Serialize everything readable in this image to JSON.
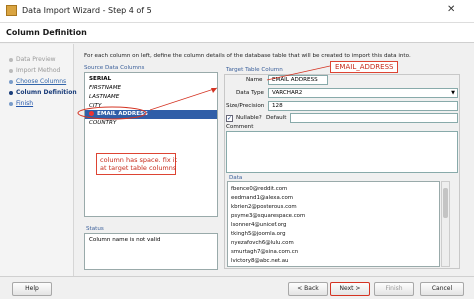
{
  "window": {
    "title": "Data Import Wizard - Step 4 of 5",
    "close_glyph": "✕"
  },
  "header": {
    "title": "Column Definition"
  },
  "steps": [
    {
      "label": "Data Preview",
      "state": "disabled"
    },
    {
      "label": "Import Method",
      "state": "disabled"
    },
    {
      "label": "Choose Columns",
      "state": "done"
    },
    {
      "label": "Column Definition",
      "state": "current"
    },
    {
      "label": "Finish",
      "state": "next"
    }
  ],
  "instructions": "For each column on left, define the column details of the database table that will be created to import this data into.",
  "source": {
    "label": "Source Data Columns",
    "columns": [
      "SERIAL",
      "FIRSTNAME",
      "LASTNAME",
      "CITY",
      "EMAIL ADDRESS",
      "COUNTRY"
    ],
    "selected_index": 4
  },
  "status": {
    "label": "Status",
    "text": "Column name is not valid"
  },
  "target": {
    "label": "Target Table Column",
    "name_label": "Name",
    "name_value": "EMAIL ADDRESS",
    "datatype_label": "Data Type",
    "datatype_value": "VARCHAR2",
    "size_label": "Size/Precision",
    "size_value": "128",
    "nullable_label": "Nullable?",
    "nullable_checked": true,
    "default_label": "Default",
    "default_value": "",
    "comment_label": "Comment",
    "comment_value": ""
  },
  "data": {
    "label": "Data",
    "rows": [
      "fbence0@reddit.com",
      "eedmand1@alexa.com",
      "kbrien2@posterous.com",
      "psyme3@squarespace.com",
      "lsonner4@unicef.org",
      "tkingh5@joomla.org",
      "nyezafovch6@lulu.com",
      "smurtagh7@sina.com.cn",
      "lvictory8@abc.net.au"
    ]
  },
  "buttons": {
    "help": "Help",
    "back": "< Back",
    "next": "Next >",
    "finish": "Finish",
    "cancel": "Cancel"
  },
  "annotations": {
    "email_callout": "EMAIL_ADDRESS",
    "note_line1": "column has space. fix it",
    "note_line2": "at target table columns"
  },
  "colors": {
    "selection": "#2f5ea8",
    "annotation": "#d43322"
  }
}
